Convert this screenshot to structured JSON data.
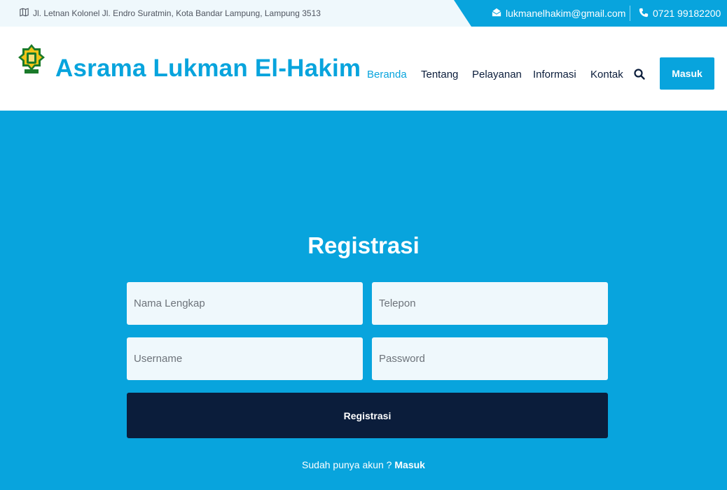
{
  "topbar": {
    "address": "Jl. Letnan Kolonel Jl. Endro Suratmin, Kota Bandar Lampung, Lampung 3513",
    "email": "lukmanelhakim@gmail.com",
    "phone": "0721 99182200"
  },
  "header": {
    "brand": "Asrama Lukman El-Hakim",
    "nav": [
      "Beranda",
      "Tentang",
      "Pelayanan",
      "Informasi",
      "Kontak"
    ],
    "active_nav": "Beranda",
    "login_button": "Masuk"
  },
  "form": {
    "title": "Registrasi",
    "fields": {
      "full_name_placeholder": "Nama Lengkap",
      "phone_placeholder": "Telepon",
      "username_placeholder": "Username",
      "password_placeholder": "Password"
    },
    "submit_label": "Registrasi",
    "have_account_text": "Sudah punya akun ?",
    "login_link": "Masuk"
  },
  "colors": {
    "accent": "#08a4dd",
    "dark": "#0b1d3b",
    "field_bg": "#eff8fc"
  }
}
